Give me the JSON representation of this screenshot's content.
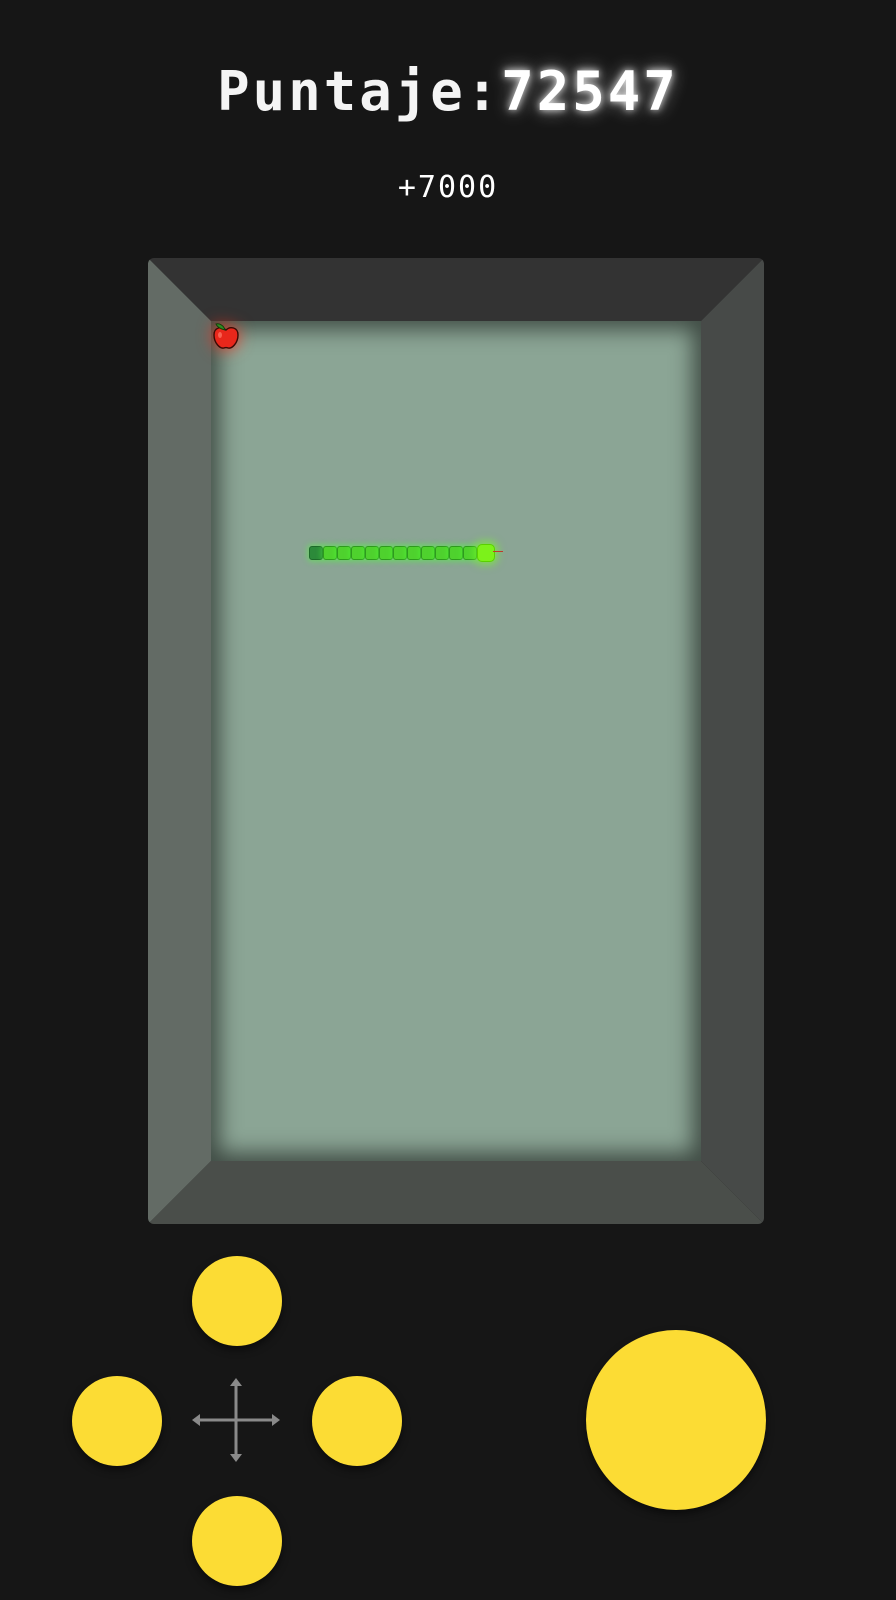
{
  "hud": {
    "score_label": "Puntaje:",
    "score_value": "72547",
    "bonus_text": "+7000"
  },
  "board": {
    "snake_length": 13,
    "direction": "right",
    "food": "apple-icon"
  },
  "controls": {
    "dpad": [
      "up",
      "left",
      "right",
      "down"
    ],
    "action": "action"
  },
  "colors": {
    "background": "#161616",
    "screen": "#8ba595",
    "snake": "#4fd12e",
    "snake_head": "#7cf21a",
    "apple": "#e8271b",
    "button": "#fcdc34"
  }
}
